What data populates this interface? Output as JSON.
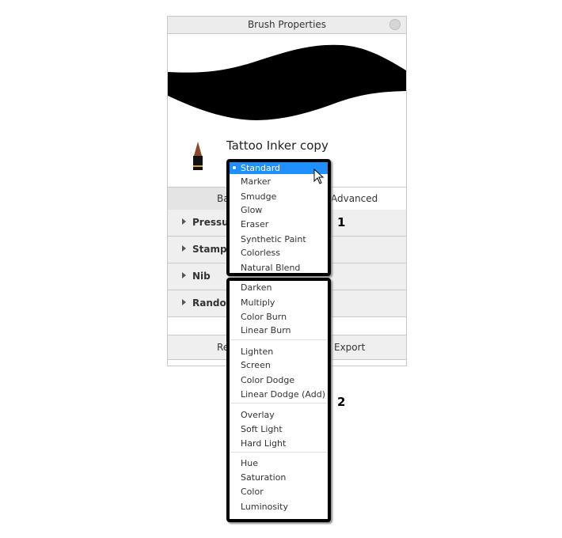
{
  "window": {
    "title": "Brush Properties"
  },
  "brush": {
    "name": "Tattoo Inker copy"
  },
  "tabs": [
    {
      "label": "Basic"
    },
    {
      "label": "Advanced"
    }
  ],
  "sections": [
    {
      "label": "Pressure"
    },
    {
      "label": "Stamp"
    },
    {
      "label": "Nib"
    },
    {
      "label": "Randomize"
    }
  ],
  "footer": {
    "reset_label": "Reset",
    "export_label": "Export"
  },
  "menu1": {
    "selected": "Standard",
    "items": [
      "Standard",
      "Marker",
      "Smudge",
      "Glow",
      "Eraser",
      "Synthetic Paint",
      "Colorless",
      "Natural Blend"
    ]
  },
  "menu2": {
    "groups": [
      [
        "Darken",
        "Multiply",
        "Color Burn",
        "Linear Burn"
      ],
      [
        "Lighten",
        "Screen",
        "Color Dodge",
        "Linear Dodge (Add)"
      ],
      [
        "Overlay",
        "Soft Light",
        "Hard Light"
      ],
      [
        "Hue",
        "Saturation",
        "Color",
        "Luminosity"
      ]
    ]
  },
  "callouts": [
    "1",
    "2"
  ],
  "colors": {
    "selection": "#1e90ff"
  }
}
